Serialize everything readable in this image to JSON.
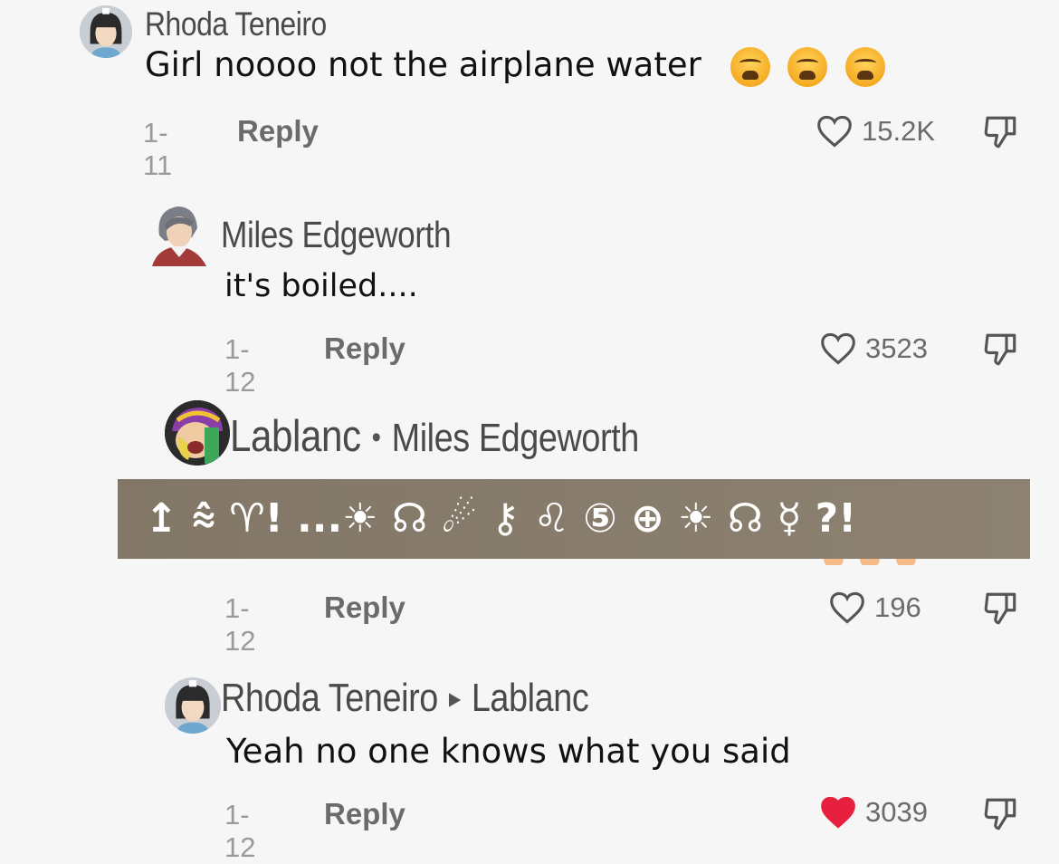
{
  "comments": [
    {
      "author": "Rhoda Teneiro",
      "text": "Girl noooo not the airplane water",
      "emoji": [
        "weary-face",
        "weary-face",
        "weary-face"
      ],
      "date": "1-11",
      "reply_label": "Reply",
      "likes": "15.2K",
      "liked": false
    },
    {
      "author": "Miles Edgeworth",
      "text": "it's boiled....",
      "date": "1-12",
      "reply_label": "Reply",
      "likes": "3523",
      "liked": false
    },
    {
      "author": "Lablanc",
      "reply_to": "Miles Edgeworth",
      "separator": "•",
      "text_overlay": "↥ ⩯ ♈! ...☀ ☊ ☄ ⚷ ♌ ⑤ ⊕ ☀ ☊ ☿ ?!",
      "date": "1-12",
      "reply_label": "Reply",
      "likes": "196",
      "liked": false
    },
    {
      "author": "Rhoda Teneiro",
      "reply_to": "Lablanc",
      "separator": "▸",
      "text": "Yeah no one knows what you said",
      "date": "1-12",
      "reply_label": "Reply",
      "likes": "3039",
      "liked": true
    }
  ],
  "colors": {
    "like_active": "#e8203f",
    "text_primary": "#111111",
    "text_muted": "#9a9a9a",
    "cipher_bar": "#7a6e5c"
  }
}
